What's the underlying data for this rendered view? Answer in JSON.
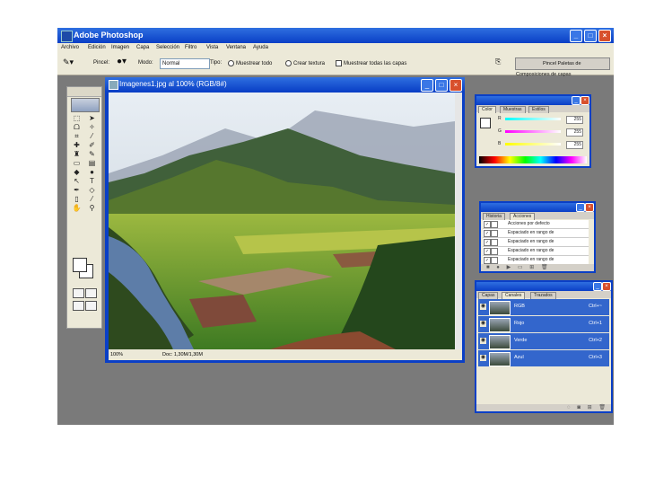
{
  "app": {
    "title": "Adobe Photoshop"
  },
  "menubar": {
    "items": [
      "Archivo",
      "Edición",
      "Imagen",
      "Capa",
      "Selección",
      "Filtro",
      "Vista",
      "Ventana",
      "Ayuda"
    ]
  },
  "options": {
    "pincel_label": "Pincel:",
    "modo_label": "Modo:",
    "modo_value": "Normal",
    "tipo_label": "Tipo:",
    "radio1": "Muestrear todo",
    "radio2": "Crear textura",
    "checkbox": "Muestrear todas las capas",
    "well_label": "Pincel  Paletas de Composiciones de capas"
  },
  "document": {
    "title": "Imagenes1.jpg al 100% (RGB/8#)",
    "zoom": "100%",
    "doc_info": "Doc: 1,30M/1,30M"
  },
  "color_panel": {
    "tabs": [
      "Color",
      "Muestras",
      "Estilos"
    ],
    "rows": [
      {
        "label": "R",
        "value": "255",
        "color": "#e03030"
      },
      {
        "label": "G",
        "value": "255",
        "color": "#30c030"
      },
      {
        "label": "B",
        "value": "255",
        "color": "#3040e0"
      }
    ]
  },
  "actions_panel": {
    "tabs": [
      "Historia",
      "Acciones"
    ],
    "rows": [
      "Acciones por defecto",
      "Espaciado en rango de",
      "Espaciado en rango de",
      "Espaciado en rango de",
      "Espaciado en rango de"
    ]
  },
  "channels_panel": {
    "tabs": [
      "Capas",
      "Canales",
      "Trazados"
    ],
    "rows": [
      {
        "name": "RGB",
        "shortcut": "Ctrl+~"
      },
      {
        "name": "Rojo",
        "shortcut": "Ctrl+1"
      },
      {
        "name": "Verde",
        "shortcut": "Ctrl+2"
      },
      {
        "name": "Azul",
        "shortcut": "Ctrl+3"
      }
    ]
  },
  "colors": {
    "titlebar": "#0a3fc6",
    "workspace": "#7a7a7a",
    "selected_row": "#3366cc"
  }
}
